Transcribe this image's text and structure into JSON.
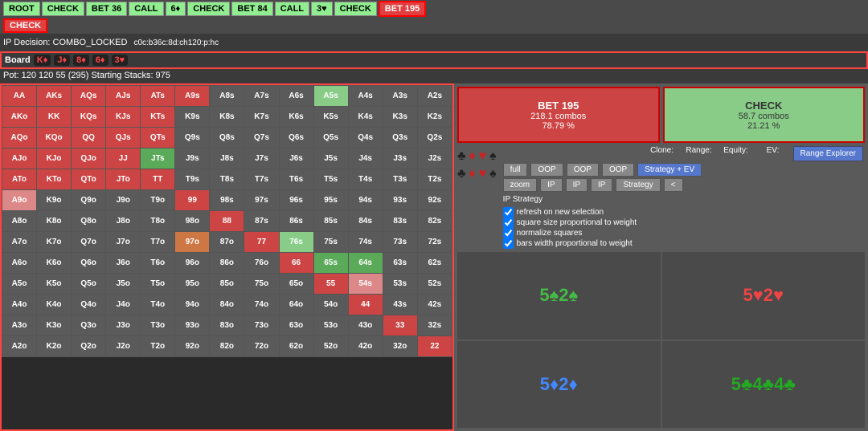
{
  "topNav": {
    "buttons": [
      {
        "label": "ROOT",
        "style": "green"
      },
      {
        "label": "CHECK",
        "style": "green"
      },
      {
        "label": "BET 36",
        "style": "green"
      },
      {
        "label": "CALL",
        "style": "green"
      },
      {
        "label": "6♦",
        "style": "green"
      },
      {
        "label": "CHECK",
        "style": "green"
      },
      {
        "label": "BET 84",
        "style": "green"
      },
      {
        "label": "CALL",
        "style": "green"
      },
      {
        "label": "3♥",
        "style": "green"
      },
      {
        "label": "CHECK",
        "style": "green"
      },
      {
        "label": "BET 195",
        "style": "active-red"
      }
    ]
  },
  "secondRow": {
    "buttons": [
      {
        "label": "CHECK",
        "style": "active"
      }
    ]
  },
  "infoRow": {
    "ipDecision": "IP Decision: COMBO_LOCKED",
    "path": "c0c:b36c:8d:ch120:p:hc"
  },
  "boardRow": {
    "label": "Board",
    "cards": [
      {
        "value": "K♦",
        "color": "red"
      },
      {
        "value": "J♦",
        "color": "red"
      },
      {
        "value": "8♦",
        "color": "red"
      },
      {
        "value": "6♦",
        "color": "red"
      },
      {
        "value": "3♥",
        "color": "red"
      }
    ]
  },
  "potRow": {
    "text": "Pot: 120 120 55 (295) Starting Stacks: 975"
  },
  "actionBoxes": {
    "bet": {
      "label": "BET 195",
      "combos": "218.1 combos",
      "pct": "78.79 %"
    },
    "check": {
      "label": "CHECK",
      "combos": "58.7 combos",
      "pct": "21.21 %"
    }
  },
  "suits": {
    "row1": [
      "♣",
      "♦",
      "♥",
      "♠"
    ],
    "row2": [
      "♣",
      "♦",
      "♥",
      "♠"
    ]
  },
  "controls": {
    "cloneLabel": "Clone:",
    "rangeLabel": "Range:",
    "equityLabel": "Equity:",
    "evLabel": "EV:",
    "rangeExplorerBtn": "Range Explorer",
    "fullBtn": "full",
    "oopBtn1": "OOP",
    "oopBtn2": "OOP",
    "oopBtn3": "OOP",
    "strategyEvBtn": "Strategy + EV",
    "zoomBtn": "zoom",
    "ipBtn1": "IP",
    "ipBtn2": "IP",
    "ipBtn3": "IP",
    "strategyBtn": "Strategy",
    "arrowBtn": "<"
  },
  "checkboxes": [
    {
      "label": "refresh on new selection",
      "checked": true
    },
    {
      "label": "square size proportional to weight",
      "checked": true
    },
    {
      "label": "normalize squares",
      "checked": true
    },
    {
      "label": "bars width proportional to weight",
      "checked": true
    }
  ],
  "ipStrategyLabel": "IP Strategy",
  "boardCards": [
    {
      "value": "5♠2♠",
      "colorClass": "bc-green"
    },
    {
      "value": "5♥2♥",
      "colorClass": "bc-red"
    },
    {
      "value": "5♦2♦",
      "colorClass": "bc-blue"
    },
    {
      "value": "5♣4♣4♣",
      "colorClass": "bc-dark-green"
    }
  ],
  "grid": {
    "rows": [
      [
        "AA",
        "AKs",
        "AQs",
        "AJs",
        "ATs",
        "A9s",
        "A8s",
        "A7s",
        "A6s",
        "A5s",
        "A4s",
        "A3s",
        "A2s"
      ],
      [
        "AKo",
        "KK",
        "KQs",
        "KJs",
        "KTs",
        "K9s",
        "K8s",
        "K7s",
        "K6s",
        "K5s",
        "K4s",
        "K3s",
        "K2s"
      ],
      [
        "AQo",
        "KQo",
        "QQ",
        "QJs",
        "QTs",
        "Q9s",
        "Q8s",
        "Q7s",
        "Q6s",
        "Q5s",
        "Q4s",
        "Q3s",
        "Q2s"
      ],
      [
        "AJo",
        "KJo",
        "QJo",
        "JJ",
        "JTs",
        "J9s",
        "J8s",
        "J7s",
        "J6s",
        "J5s",
        "J4s",
        "J3s",
        "J2s"
      ],
      [
        "ATo",
        "KTo",
        "QTo",
        "JTo",
        "TT",
        "T9s",
        "T8s",
        "T7s",
        "T6s",
        "T5s",
        "T4s",
        "T3s",
        "T2s"
      ],
      [
        "A9o",
        "K9o",
        "Q9o",
        "J9o",
        "T9o",
        "99",
        "98s",
        "97s",
        "96s",
        "95s",
        "94s",
        "93s",
        "92s"
      ],
      [
        "A8o",
        "K8o",
        "Q8o",
        "J8o",
        "T8o",
        "98o",
        "88",
        "87s",
        "86s",
        "85s",
        "84s",
        "83s",
        "82s"
      ],
      [
        "A7o",
        "K7o",
        "Q7o",
        "J7o",
        "T7o",
        "97o",
        "87o",
        "77",
        "76s",
        "75s",
        "74s",
        "73s",
        "72s"
      ],
      [
        "A6o",
        "K6o",
        "Q6o",
        "J6o",
        "T6o",
        "96o",
        "86o",
        "76o",
        "66",
        "65s",
        "64s",
        "63s",
        "62s"
      ],
      [
        "A5o",
        "K5o",
        "Q5o",
        "J5o",
        "T5o",
        "95o",
        "85o",
        "75o",
        "65o",
        "55",
        "54s",
        "53s",
        "52s"
      ],
      [
        "A4o",
        "K4o",
        "Q4o",
        "J4o",
        "T4o",
        "94o",
        "84o",
        "74o",
        "64o",
        "54o",
        "44",
        "43s",
        "42s"
      ],
      [
        "A3o",
        "K3o",
        "Q3o",
        "J3o",
        "T3o",
        "93o",
        "83o",
        "73o",
        "63o",
        "53o",
        "43o",
        "33",
        "32s"
      ],
      [
        "A2o",
        "K2o",
        "Q2o",
        "J2o",
        "T2o",
        "92o",
        "82o",
        "72o",
        "62o",
        "52o",
        "42o",
        "32o",
        "22"
      ]
    ],
    "colors": [
      [
        "red",
        "red",
        "red",
        "red",
        "red",
        "red",
        "default",
        "default",
        "default",
        "light-green",
        "default",
        "default",
        "default"
      ],
      [
        "red",
        "red",
        "red",
        "red",
        "red",
        "default",
        "default",
        "default",
        "default",
        "default",
        "default",
        "default",
        "default"
      ],
      [
        "red",
        "red",
        "red",
        "red",
        "red",
        "default",
        "default",
        "default",
        "default",
        "default",
        "default",
        "default",
        "default"
      ],
      [
        "red",
        "red",
        "red",
        "red",
        "green",
        "default",
        "default",
        "default",
        "default",
        "default",
        "default",
        "default",
        "default"
      ],
      [
        "red",
        "red",
        "red",
        "red",
        "red",
        "default",
        "default",
        "default",
        "default",
        "default",
        "default",
        "default",
        "default"
      ],
      [
        "salmon",
        "default",
        "default",
        "default",
        "default",
        "red",
        "default",
        "default",
        "default",
        "default",
        "default",
        "default",
        "default"
      ],
      [
        "default",
        "default",
        "default",
        "default",
        "default",
        "default",
        "red",
        "default",
        "default",
        "default",
        "default",
        "default",
        "default"
      ],
      [
        "default",
        "default",
        "default",
        "default",
        "default",
        "orange",
        "default",
        "red",
        "light-green",
        "default",
        "default",
        "default",
        "default"
      ],
      [
        "default",
        "default",
        "default",
        "default",
        "default",
        "default",
        "default",
        "default",
        "red",
        "green",
        "green",
        "default",
        "default"
      ],
      [
        "default",
        "default",
        "default",
        "default",
        "default",
        "default",
        "default",
        "default",
        "default",
        "red",
        "salmon",
        "default",
        "default"
      ],
      [
        "default",
        "default",
        "default",
        "default",
        "default",
        "default",
        "default",
        "default",
        "default",
        "default",
        "red",
        "default",
        "default"
      ],
      [
        "default",
        "default",
        "default",
        "default",
        "default",
        "default",
        "default",
        "default",
        "default",
        "default",
        "default",
        "red",
        "default"
      ],
      [
        "default",
        "default",
        "default",
        "default",
        "default",
        "default",
        "default",
        "default",
        "default",
        "default",
        "default",
        "default",
        "red"
      ]
    ]
  }
}
